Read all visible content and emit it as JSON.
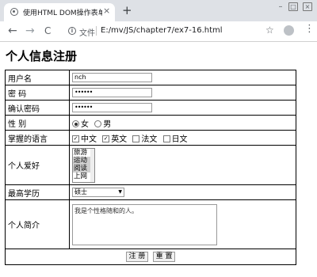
{
  "browser": {
    "tab_title": "使用HTML DOM操作表单及表单",
    "tab_close": "×",
    "new_tab": "+",
    "back": "←",
    "forward": "→",
    "reload": "C",
    "info": "i",
    "address_label": "文件",
    "url": "E:/mv/JS/chapter7/ex7-16.html",
    "star": "☆",
    "menu": "⋮",
    "min": "–",
    "max": "□",
    "close": "×"
  },
  "page": {
    "title": "个人信息注册"
  },
  "form": {
    "username_label": "用户名",
    "username_value": "nch",
    "password_label": "密 码",
    "password_value": "••••••",
    "confirm_label": "确认密码",
    "confirm_value": "••••••",
    "gender_label": "性 别",
    "gender_options": [
      "女",
      "男"
    ],
    "language_label": "掌握的语言",
    "languages": [
      "中文",
      "英文",
      "法文",
      "日文"
    ],
    "hobby_label": "个人爱好",
    "hobbies": [
      "旅游",
      "运动",
      "阅读",
      "上网"
    ],
    "education_label": "最高学历",
    "education_value": "硕士",
    "bio_label": "个人简介",
    "bio_value": "我是个性格随和的人。",
    "submit_label": "注 册",
    "reset_label": "重 置"
  }
}
